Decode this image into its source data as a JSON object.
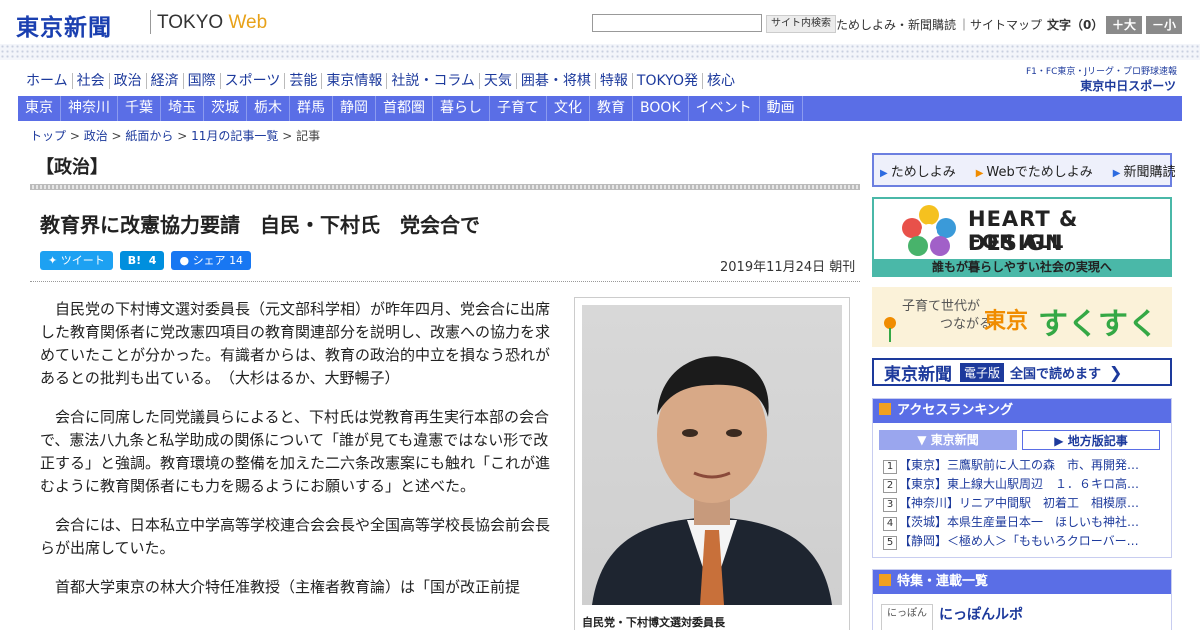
{
  "header": {
    "logo": "東京新聞",
    "logo_sub_tokyo": "TOKYO",
    "logo_sub_web": "Web",
    "search_placeholder": "",
    "search_button": "サイト内検索",
    "links": [
      "ためしよみ・新聞購読",
      "サイトマップ"
    ],
    "font_size_label": "文字（0）",
    "font_plus": "＋大",
    "font_minus": "－小"
  },
  "nav_main": [
    "ホーム",
    "社会",
    "政治",
    "経済",
    "国際",
    "スポーツ",
    "芸能",
    "東京情報",
    "社説・コラム",
    "天気",
    "囲碁・将棋",
    "特報",
    "TOKYO発",
    "核心"
  ],
  "chunichi": {
    "small": "F1・FC東京・Jリーグ・プロ野球速報",
    "big": "東京中日スポーツ"
  },
  "nav_sub": [
    "東京",
    "神奈川",
    "千葉",
    "埼玉",
    "茨城",
    "栃木",
    "群馬",
    "静岡",
    "首都圏",
    "暮らし",
    "子育て",
    "文化",
    "教育",
    "BOOK",
    "イベント",
    "動画"
  ],
  "breadcrumb": {
    "items": [
      "トップ",
      "政治",
      "紙面から",
      "11月の記事一覧"
    ],
    "current": "記事",
    "sep": " > "
  },
  "section_title": "【政治】",
  "article": {
    "headline": "教育界に改憲協力要請　自民・下村氏　党会合で",
    "share": {
      "tweet": "ツイート",
      "hatena": "B!",
      "hatena_count": "4",
      "fb": "シェア",
      "fb_count": "14"
    },
    "date": "2019年11月24日 朝刊",
    "paragraphs": [
      "自民党の下村博文選対委員長（元文部科学相）が昨年四月、党会合に出席した教育関係者に党改憲四項目の教育関連部分を説明し、改憲への協力を求めていたことが分かった。有識者からは、教育の政治的中立を損なう恐れがあるとの批判も出ている。　（大杉はるか、大野暢子）",
      "会合に同席した同党議員らによると、下村氏は党教育再生実行本部の会合で、憲法八九条と私学助成の関係について「誰が見ても違憲ではない形で改正する」と強調。教育環境の整備を加えた二六条改憲案にも触れ「これが進むように教育関係者にも力を賜るようにお願いする」と述べた。",
      "会合には、日本私立中学高等学校連合会会長や全国高等学校長協会前会長らが出席していた。",
      "首都大学東京の林大介特任准教授（主権者教育論）は「国が改正前提"
    ],
    "photo_caption": "自民党・下村博文選対委員長"
  },
  "sidebar": {
    "trial": [
      "ためしよみ",
      "Webでためしよみ",
      "新聞購読"
    ],
    "heart_line1": "HEART & DESIGN",
    "heart_line2": "FOR ALL",
    "heart_bar": "誰もが暮らしやすい社会の実現へ",
    "suku1": "子育て世代が",
    "suku2": "つながる",
    "suku3": "東京",
    "suku4": "すくすく",
    "edition_name": "東京新聞",
    "edition_tag": "電子版",
    "edition_text": "全国で読めます",
    "ranking_title": "アクセスランキング",
    "ranking_tabs": [
      "東京新聞",
      "地方版記事"
    ],
    "ranking_items": [
      "【東京】三鷹駅前に人工の森　市、再開発…",
      "【東京】東上線大山駅周辺　１．６キロ高…",
      "【神奈川】リニア中間駅　初着工　相模原…",
      "【茨城】本県生産量日本一　ほしいも神社…",
      "【静岡】＜極め人＞「ももいろクローバー…"
    ],
    "feature_title": "特集・連載一覧",
    "feature_item": "にっぽんルポ",
    "feature_thumb": "にっぽん"
  },
  "colors": {
    "brand_blue": "#1d3a9c",
    "nav_blue": "#5a6ee6",
    "teal": "#4ab8a8",
    "orange": "#f08c00"
  }
}
